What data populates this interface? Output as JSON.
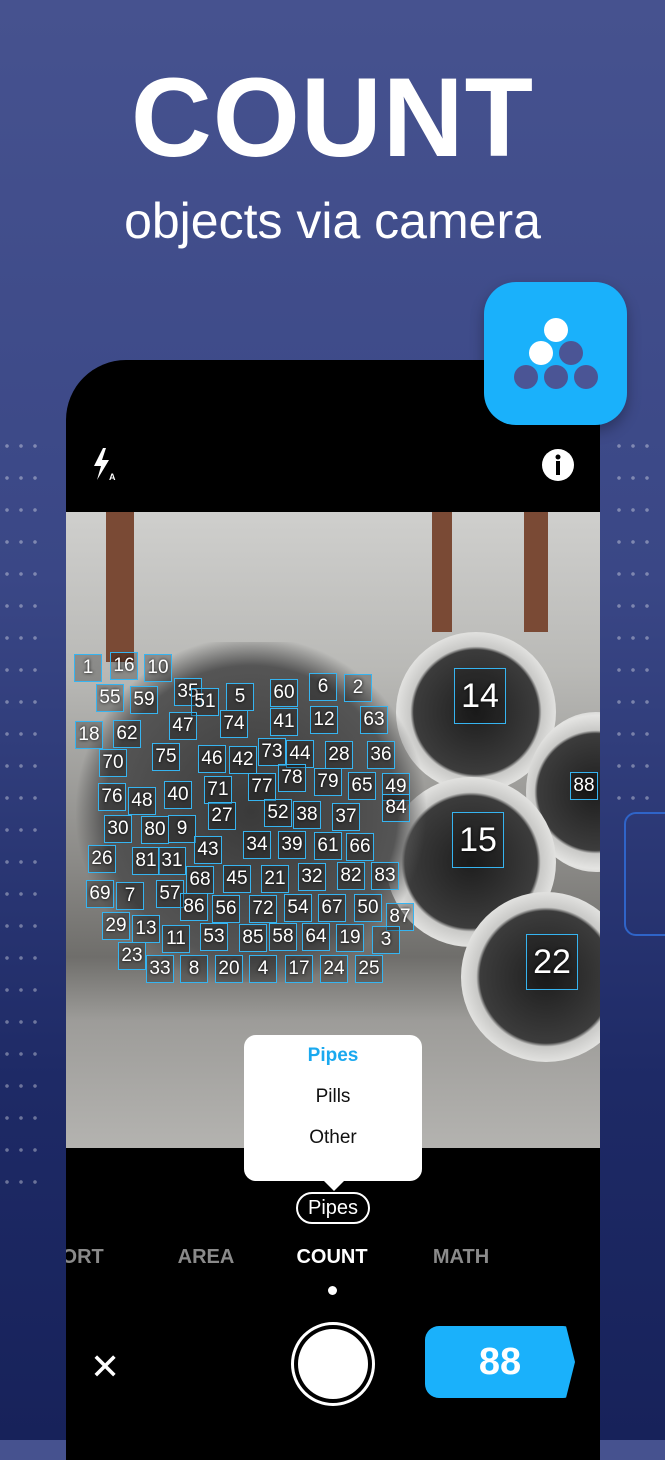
{
  "headline": {
    "title": "COUNT",
    "subtitle": "objects via camera"
  },
  "colors": {
    "accent": "#1ab1fb",
    "background": "#3a4786",
    "marker": "#36b4f0"
  },
  "app_icon": {
    "icon": "pyramid-dots-icon"
  },
  "top_bar": {
    "flash_icon": "flash-auto-icon",
    "flash_badge": "A",
    "info_icon": "info-icon"
  },
  "markers": [
    "1",
    "16",
    "10",
    "55",
    "59",
    "35",
    "51",
    "5",
    "60",
    "6",
    "2",
    "47",
    "74",
    "41",
    "12",
    "63",
    "18",
    "62",
    "75",
    "46",
    "42",
    "73",
    "44",
    "28",
    "36",
    "70",
    "71",
    "77",
    "78",
    "79",
    "65",
    "49",
    "76",
    "48",
    "40",
    "84",
    "27",
    "52",
    "38",
    "37",
    "30",
    "80",
    "9",
    "43",
    "34",
    "39",
    "61",
    "66",
    "26",
    "81",
    "31",
    "68",
    "45",
    "21",
    "32",
    "82",
    "83",
    "69",
    "7",
    "57",
    "86",
    "56",
    "72",
    "54",
    "67",
    "50",
    "87",
    "29",
    "13",
    "11",
    "53",
    "85",
    "58",
    "64",
    "19",
    "3",
    "23",
    "33",
    "8",
    "20",
    "4",
    "17",
    "24",
    "25"
  ],
  "big_markers": [
    "14",
    "15",
    "22",
    "88"
  ],
  "category_menu": {
    "options": [
      "Pipes",
      "Pills",
      "Other"
    ],
    "selected": "Pipes"
  },
  "category_chip": "Pipes",
  "modes": [
    {
      "label": "PORT"
    },
    {
      "label": "AREA"
    },
    {
      "label": "COUNT",
      "active": true
    },
    {
      "label": "MATH"
    }
  ],
  "bottom": {
    "close_icon": "close-icon",
    "count": "88"
  }
}
